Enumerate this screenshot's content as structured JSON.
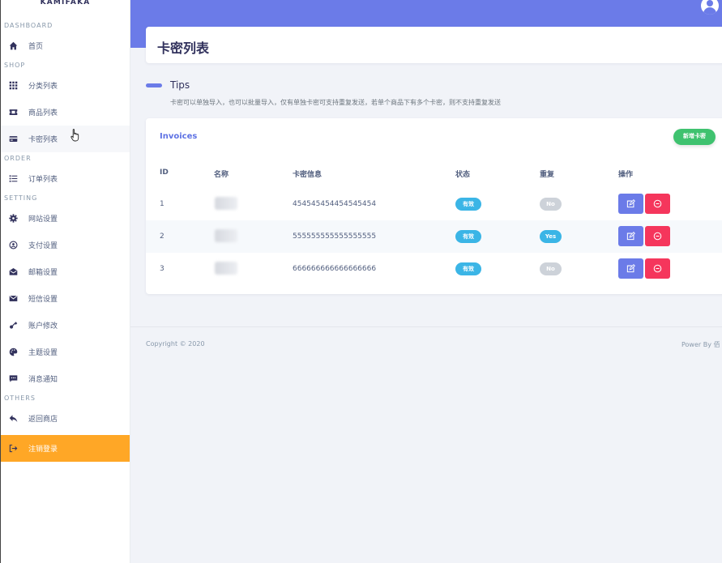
{
  "brand": "KAMIFAKA",
  "sidebar": {
    "sections": {
      "dashboard": "DASHBOARD",
      "shop": "SHOP",
      "order": "ORDER",
      "setting": "SETTING",
      "others": "OTHERS"
    },
    "items": {
      "home": "首页",
      "categories": "分类列表",
      "products": "商品列表",
      "cards": "卡密列表",
      "orders": "订单列表",
      "site_settings": "网站设置",
      "payment_settings": "支付设置",
      "mail_settings": "邮箱设置",
      "sms_settings": "短信设置",
      "account": "账户修改",
      "theme": "主题设置",
      "notify": "消息通知",
      "back_shop": "返回商店",
      "logout": "注销登录"
    },
    "active_item": "卡密列表",
    "colors": {
      "logout_bg": "#ffa726",
      "active_bg": "#f6f7fa"
    }
  },
  "header": {
    "page_title": "卡密列表",
    "bg_color": "#6b7be8"
  },
  "tips": {
    "title": "Tips",
    "text": "卡密可以单独导入，也可以批量导入，仅有单独卡密可支持重复发送，若单个商品下有多个卡密，则不支持重复发送"
  },
  "invoices": {
    "title": "Invoices",
    "add_button": "新增卡密",
    "columns": {
      "id": "ID",
      "name": "名称",
      "info": "卡密信息",
      "status": "状态",
      "repeat": "重复",
      "actions": "操作"
    },
    "rows": [
      {
        "id": "1",
        "info": "454545454454545454",
        "status": "有效",
        "repeat": "No"
      },
      {
        "id": "2",
        "info": "555555555555555555",
        "status": "有效",
        "repeat": "Yes"
      },
      {
        "id": "3",
        "info": "666666666666666666",
        "status": "有效",
        "repeat": "No"
      }
    ],
    "colors": {
      "valid": "#3bb5e6",
      "no": "#cdd2d9",
      "edit": "#6b7be8",
      "delete": "#f5365c",
      "add": "#3fc26f"
    }
  },
  "footer": {
    "copyright": "Copyright © 2020",
    "powered_by": "Power By 佰"
  }
}
